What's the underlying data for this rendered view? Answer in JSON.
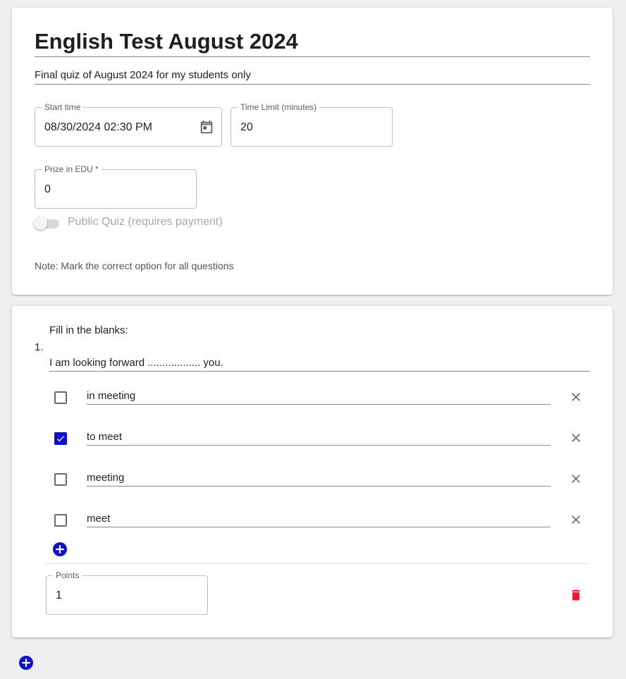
{
  "quiz": {
    "title": "English Test August 2024",
    "description": "Final quiz of August 2024 for my students only",
    "start_time": {
      "label": "Start time",
      "value": "08/30/2024 02:30 PM"
    },
    "time_limit": {
      "label": "Time Limit (minutes)",
      "value": "20"
    },
    "prize": {
      "label": "Prize in EDU *",
      "value": "0"
    },
    "public_quiz": {
      "label": "Public Quiz (requires payment)",
      "enabled": false
    },
    "note": "Note: Mark the correct option for all questions"
  },
  "question": {
    "number": "1.",
    "text_line1": "Fill in the blanks:",
    "text_line2": "I am looking forward .................. you.",
    "options": [
      {
        "text": "in meeting",
        "checked": false
      },
      {
        "text": "to meet",
        "checked": true
      },
      {
        "text": "meeting",
        "checked": false
      },
      {
        "text": "meet",
        "checked": false
      }
    ],
    "points": {
      "label": "Points",
      "value": "1"
    }
  },
  "colors": {
    "accent": "#0f11c4",
    "delete": "#f0173d",
    "background": "#eeeeee"
  },
  "icons": [
    "calendar-icon",
    "close-icon",
    "add-circle-icon",
    "trash-icon",
    "check-icon"
  ]
}
